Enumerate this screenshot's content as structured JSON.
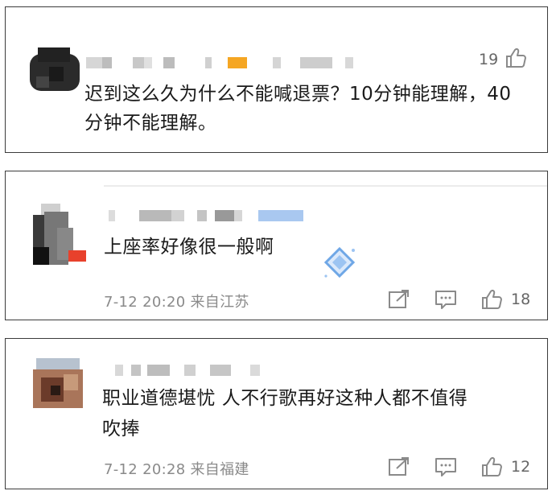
{
  "comments": [
    {
      "text": "迟到这么久为什么不能喊退票？10分钟能理解，40分钟不能理解。",
      "likes": "19",
      "meta": ""
    },
    {
      "text": "上座率好像很一般啊",
      "meta": "7-12 20:20 来自江苏",
      "likes": "18"
    },
    {
      "text_line1": "职业道德堪忧 人不行歌再好这种人都不值得",
      "text_line2": "吹捧",
      "meta": "7-12 20:28 来自福建",
      "likes": "12"
    }
  ],
  "colors": {
    "border": "#3b3b3b",
    "meta_text": "#8a8a8a",
    "icon": "#8a8a8a",
    "orange_tag": "#f5a623",
    "blue_tag": "#a9c8f0",
    "diamond": "#6fa7e6"
  },
  "icons": [
    "thumbs-up-icon",
    "share-icon",
    "comment-icon",
    "diamond-badge-icon"
  ]
}
